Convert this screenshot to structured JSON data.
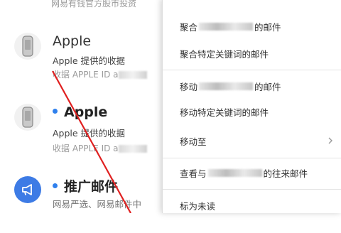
{
  "mail_list": {
    "top_snippet": "网易有钱官方股市投资",
    "items": [
      {
        "sender": "Apple",
        "unread": false,
        "subject": "Apple 提供的收据",
        "preview": "收据 APPLE ID a",
        "avatar_icon": "apple-phone-icon"
      },
      {
        "sender": "Apple",
        "unread": true,
        "subject": "Apple 提供的收据",
        "preview": "收据 APPLE ID a",
        "avatar_icon": "apple-phone-icon"
      },
      {
        "sender": "推广邮件",
        "unread": true,
        "subject": "网易严选、网易邮件中",
        "preview": "",
        "avatar_icon": "megaphone-icon"
      }
    ]
  },
  "context_menu": {
    "items": [
      {
        "label_before": "聚合",
        "label_after": "的邮件",
        "redacted": true
      },
      {
        "label": "聚合特定关键词的邮件"
      },
      {
        "label_before": "移动",
        "label_after": "的邮件",
        "redacted": true
      },
      {
        "label": "移动特定关键词的邮件"
      },
      {
        "label": "移动至",
        "has_submenu": true
      },
      {
        "label_before": "查看与",
        "label_after": "的往来邮件",
        "redacted": true
      },
      {
        "label": "标为未读"
      }
    ]
  },
  "colors": {
    "accent_blue": "#2f80ed",
    "annotation_red": "#e02020"
  }
}
